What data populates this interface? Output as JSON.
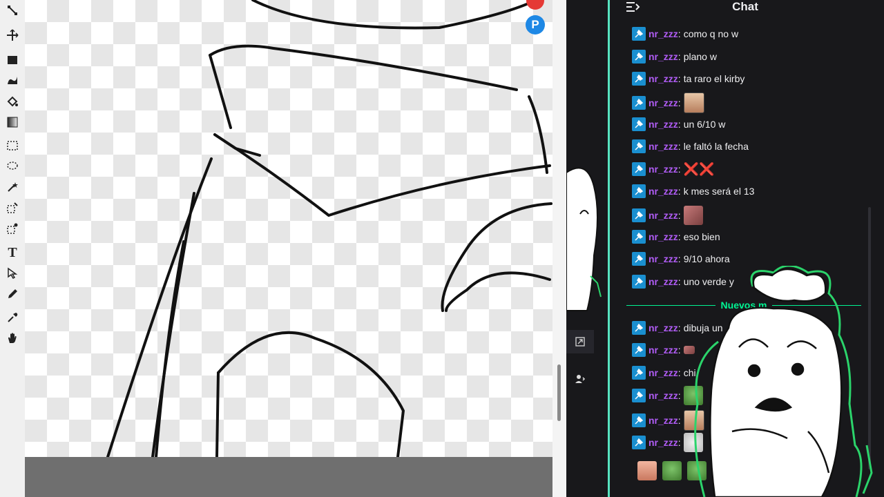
{
  "toolbar": {
    "tools": [
      {
        "name": "crop-icon"
      },
      {
        "name": "move-icon"
      },
      {
        "name": "rectangle-icon"
      },
      {
        "name": "brush-icon"
      },
      {
        "name": "fill-bucket-icon"
      },
      {
        "name": "gradient-icon"
      },
      {
        "name": "rect-select-icon"
      },
      {
        "name": "lasso-select-icon"
      },
      {
        "name": "magic-wand-icon"
      },
      {
        "name": "select-icon"
      },
      {
        "name": "select-alt-icon"
      },
      {
        "name": "text-icon",
        "glyph": "T"
      },
      {
        "name": "pointer-icon"
      },
      {
        "name": "pencil-icon"
      },
      {
        "name": "eyedropper-icon"
      },
      {
        "name": "hand-icon"
      }
    ]
  },
  "floating_icons": {
    "top_app": "app-icon",
    "p_app": {
      "glyph": "P",
      "color": "#1e88e5"
    }
  },
  "chat": {
    "title": "Chat",
    "username": "nr_zzz",
    "accent_color": "#57e3c0",
    "username_color": "#b05cf5",
    "messages": [
      {
        "text": "como q no w"
      },
      {
        "text": "plano w"
      },
      {
        "text": "ta raro el kirby"
      },
      {
        "text": "",
        "emote": "face"
      },
      {
        "text": "un 6/10 w"
      },
      {
        "text": "le faltó la fecha"
      },
      {
        "text": "",
        "special": "❌❌"
      },
      {
        "text": "k mes será el 13"
      },
      {
        "text": "",
        "emote": "blur"
      },
      {
        "text": "eso bien"
      },
      {
        "text": "9/10 ahora"
      },
      {
        "text": "uno verde y"
      }
    ],
    "new_messages_label": "Nuevos m",
    "new_messages": [
      {
        "text": "dibuja un"
      },
      {
        "text": "",
        "emote": "blur"
      },
      {
        "text": "chi"
      },
      {
        "text": "",
        "emote": "pepe"
      },
      {
        "text": "",
        "emote": "face"
      },
      {
        "text": "",
        "emote": "cat"
      }
    ]
  }
}
